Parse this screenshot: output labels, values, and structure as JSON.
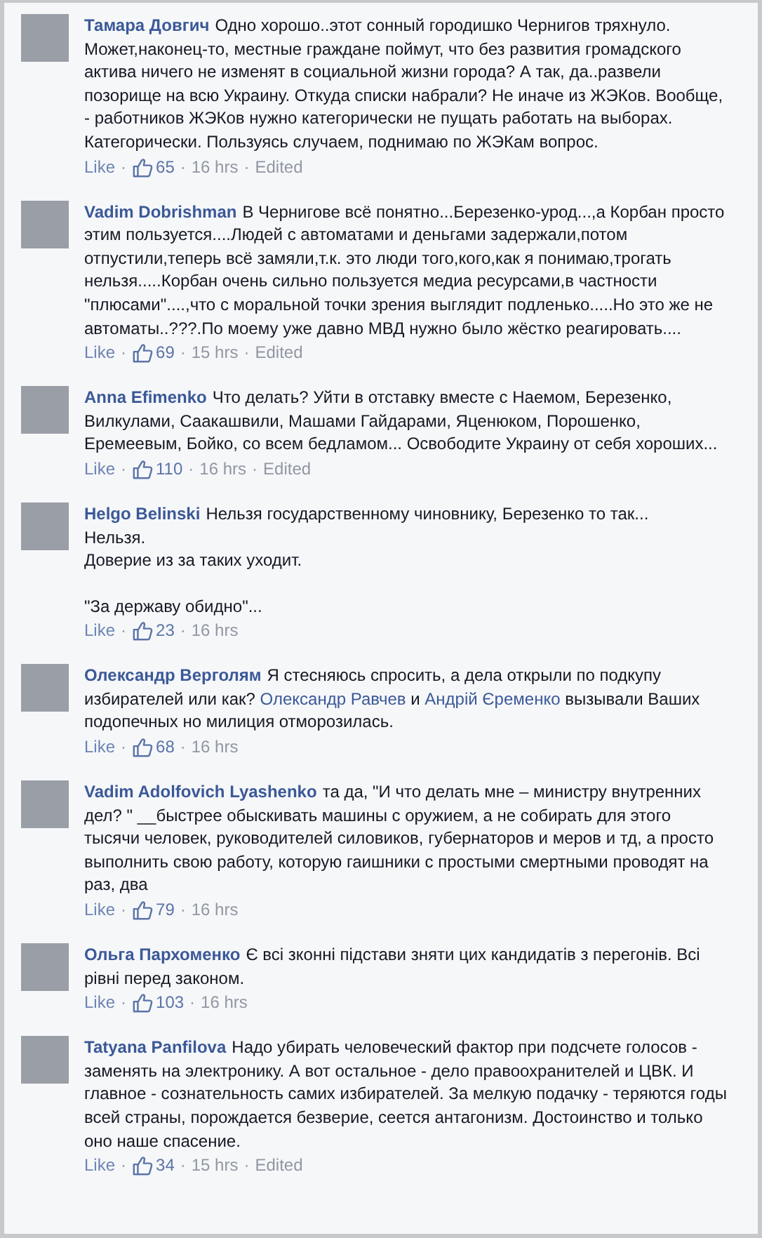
{
  "comments": [
    {
      "author": "Тамара Довгич",
      "paragraphs": [
        [
          {
            "kind": "text",
            "text": "Одно хорошо..этот сонный городишко Чернигов тряхнуло. Может,наконец-то, местные граждане поймут, что без развития громадского актива ничего не изменят в социальной жизни города? А так, да..развели позорище на всю Украину. Откуда списки набрали? Не иначе из ЖЭКов. Вообще, - работников ЖЭКов нужно категорически не пущать работать на выборах. Категорически. Пользуясь случаем, поднимаю по ЖЭКам вопрос."
          }
        ]
      ],
      "footer": [
        {
          "kind": "like",
          "text": "Like"
        },
        {
          "kind": "sep",
          "text": "·"
        },
        {
          "kind": "likes",
          "text": "65"
        },
        {
          "kind": "sep",
          "text": "·"
        },
        {
          "kind": "time",
          "text": "16 hrs"
        },
        {
          "kind": "sep",
          "text": "·"
        },
        {
          "kind": "edited",
          "text": "Edited"
        }
      ]
    },
    {
      "author": "Vadim Dobrishman",
      "paragraphs": [
        [
          {
            "kind": "text",
            "text": "В Чернигове всё понятно...Березенко-урод...,а Корбан просто этим пользуется....Людей с автоматами и деньгами задержали,потом отпустили,теперь всё замяли,т.к. это люди того,кого,как я понимаю,трогать нельзя.....Корбан очень сильно пользуется медиа ресурсами,в частности \"плюсами\"....,что с моральной точки зрения выглядит подленько.....Но это же не автоматы..???.По моему уже давно МВД нужно было жёстко реагировать...."
          }
        ]
      ],
      "footer": [
        {
          "kind": "like",
          "text": "Like"
        },
        {
          "kind": "sep",
          "text": "·"
        },
        {
          "kind": "likes",
          "text": "69"
        },
        {
          "kind": "sep",
          "text": "·"
        },
        {
          "kind": "time",
          "text": "15 hrs"
        },
        {
          "kind": "sep",
          "text": "·"
        },
        {
          "kind": "edited",
          "text": "Edited"
        }
      ]
    },
    {
      "author": "Anna Efimenko",
      "paragraphs": [
        [
          {
            "kind": "text",
            "text": "Что делать? Уйти в отставку вместе с Наемом, Березенко, Вилкулами, Саакашвили, Машами Гайдарами, Яценюком, Порошенко, Еремеевым, Бойко, со всем бедламом... Освободите Украину от себя хороших..."
          }
        ]
      ],
      "footer": [
        {
          "kind": "like",
          "text": "Like"
        },
        {
          "kind": "sep",
          "text": "·"
        },
        {
          "kind": "likes",
          "text": "110"
        },
        {
          "kind": "sep",
          "text": "·"
        },
        {
          "kind": "time",
          "text": "16 hrs"
        },
        {
          "kind": "sep",
          "text": "·"
        },
        {
          "kind": "edited",
          "text": "Edited"
        }
      ]
    },
    {
      "author": "Helgo Belinski",
      "paragraphs": [
        [
          {
            "kind": "text",
            "text": "Нельзя государственному чиновнику, Березенко то так...\nНельзя.\nДоверие из за таких уходит."
          }
        ],
        [
          {
            "kind": "text",
            "text": "\"За державу обидно\"..."
          }
        ]
      ],
      "footer": [
        {
          "kind": "like",
          "text": "Like"
        },
        {
          "kind": "sep",
          "text": "·"
        },
        {
          "kind": "likes",
          "text": "23"
        },
        {
          "kind": "sep",
          "text": "·"
        },
        {
          "kind": "time",
          "text": "16 hrs"
        }
      ]
    },
    {
      "author": "Олександр Верголям",
      "paragraphs": [
        [
          {
            "kind": "text",
            "text": "Я стесняюсь спросить, а дела открыли по подкупу избирателей или как? "
          },
          {
            "kind": "link",
            "text": "Олександр Равчев"
          },
          {
            "kind": "text",
            "text": " и "
          },
          {
            "kind": "link",
            "text": "Андрій Єременко"
          },
          {
            "kind": "text",
            "text": " вызывали Ваших подопечных но милиция отморозилась."
          }
        ]
      ],
      "footer": [
        {
          "kind": "like",
          "text": "Like"
        },
        {
          "kind": "sep",
          "text": "·"
        },
        {
          "kind": "likes",
          "text": "68"
        },
        {
          "kind": "sep",
          "text": "·"
        },
        {
          "kind": "time",
          "text": "16 hrs"
        }
      ]
    },
    {
      "author": "Vadim Adolfovich Lyashenko",
      "paragraphs": [
        [
          {
            "kind": "text",
            "text": "та да, \"И что делать мне – министру внутренних дел? \" __быстрее обыскивать машины с оружием, а не собирать для этого тысячи человек, руководителей силовиков, губернаторов и меров и тд, а просто выполнить свою работу, которую гаишники с простыми смертными проводят на раз, два"
          }
        ]
      ],
      "footer": [
        {
          "kind": "like",
          "text": "Like"
        },
        {
          "kind": "sep",
          "text": "·"
        },
        {
          "kind": "likes",
          "text": "79"
        },
        {
          "kind": "sep",
          "text": "·"
        },
        {
          "kind": "time",
          "text": "16 hrs"
        }
      ]
    },
    {
      "author": "Ольга Пархоменко",
      "paragraphs": [
        [
          {
            "kind": "text",
            "text": "Є всі зконні підстави зняти цих кандидатів з перегонів. Всі рівні перед законом."
          }
        ]
      ],
      "footer": [
        {
          "kind": "like",
          "text": "Like"
        },
        {
          "kind": "sep",
          "text": "·"
        },
        {
          "kind": "likes",
          "text": "103"
        },
        {
          "kind": "sep",
          "text": "·"
        },
        {
          "kind": "time",
          "text": "16 hrs"
        }
      ]
    },
    {
      "author": "Tatyana Panfilova",
      "paragraphs": [
        [
          {
            "kind": "text",
            "text": "Надо убирать человеческий фактор при подсчете голосов - заменять на электронику. А вот остальное - дело правоохранителей и ЦВК. И главное - сознательность самих избирателей. За мелкую подачку - теряются годы всей страны, порождается безверие, сеется антагонизм. Достоинство и только оно наше спасение."
          }
        ]
      ],
      "footer": [
        {
          "kind": "like",
          "text": "Like"
        },
        {
          "kind": "sep",
          "text": "·"
        },
        {
          "kind": "likes",
          "text": "34"
        },
        {
          "kind": "sep",
          "text": "·"
        },
        {
          "kind": "time",
          "text": "15 hrs"
        },
        {
          "kind": "sep",
          "text": "·"
        },
        {
          "kind": "edited",
          "text": "Edited"
        }
      ]
    }
  ]
}
